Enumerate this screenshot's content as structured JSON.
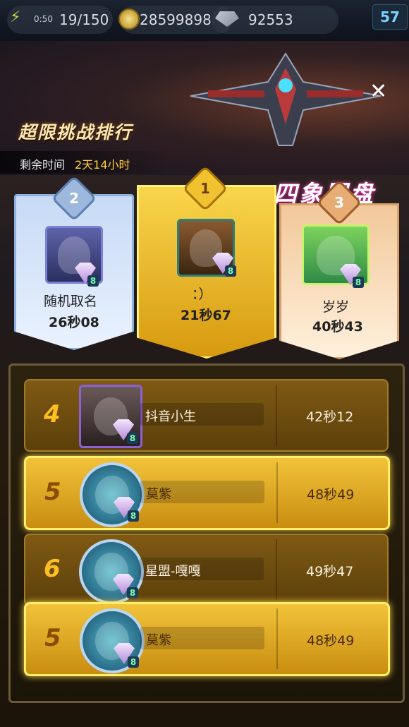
{
  "topbar": {
    "energy_timer": "0:50",
    "energy": "19/150",
    "gold": "28599898",
    "gems": "92553",
    "level": "57"
  },
  "header": {
    "title": "超限挑战排行",
    "remaining_label": "剩余时间",
    "remaining_value": "2天14小时",
    "event_name": "四象罗盘",
    "close_label": "✕"
  },
  "podium": [
    {
      "rank": "2",
      "name": "随机取名",
      "time": "26秒08",
      "vip": "8"
    },
    {
      "rank": "1",
      "name": "：）",
      "time": "21秒67",
      "vip": "8"
    },
    {
      "rank": "3",
      "name": "岁岁",
      "time": "40秒43",
      "vip": "8"
    }
  ],
  "list": [
    {
      "rank": "4",
      "name": "抖音小生",
      "time": "42秒12",
      "vip": "8"
    },
    {
      "rank": "5",
      "name": "莫紫",
      "time": "48秒49",
      "vip": "8"
    },
    {
      "rank": "6",
      "name": "星盟-嘎嘎",
      "time": "49秒47",
      "vip": "8"
    }
  ],
  "my_rank": {
    "rank": "5",
    "name": "莫紫",
    "time": "48秒49",
    "vip": "8"
  },
  "colors": {
    "accent_gold": "#ffbf24",
    "highlight": "#ffd23a",
    "event_pink": "#ff3ab4"
  }
}
